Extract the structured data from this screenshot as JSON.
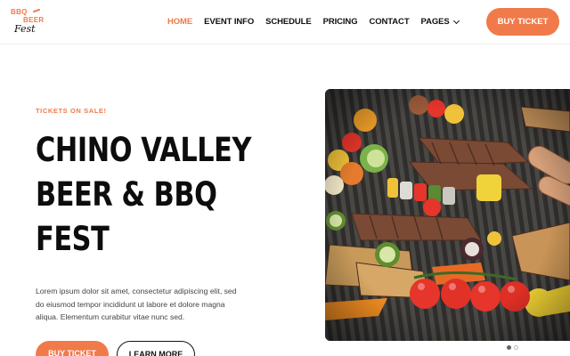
{
  "logo": {
    "line1": "BBQ",
    "line2": "BEER",
    "line3": "Fest"
  },
  "nav": {
    "items": [
      {
        "label": "HOME",
        "active": true
      },
      {
        "label": "EVENT INFO",
        "active": false
      },
      {
        "label": "SCHEDULE",
        "active": false
      },
      {
        "label": "PRICING",
        "active": false
      },
      {
        "label": "CONTACT",
        "active": false
      },
      {
        "label": "PAGES",
        "active": false,
        "has_dropdown": true
      }
    ]
  },
  "header": {
    "cta_label": "BUY TICKET"
  },
  "hero": {
    "eyebrow": "TICKETS ON SALE!",
    "title_lines": [
      "CHINO VALLEY",
      "BEER & BBQ",
      "FEST"
    ],
    "description": "Lorem ipsum dolor sit amet, consectetur adipiscing elit, sed do eiusmod tempor incididunt ut labore et dolore magna aliqua. Elementum curabitur vitae nunc sed.",
    "primary_button": "BUY TICKET",
    "secondary_button": "LEARN MORE",
    "image_alt": "grill-photo"
  },
  "carousel": {
    "current": 1,
    "total": 2
  },
  "colors": {
    "accent": "#f07a4a",
    "text": "#111111"
  }
}
